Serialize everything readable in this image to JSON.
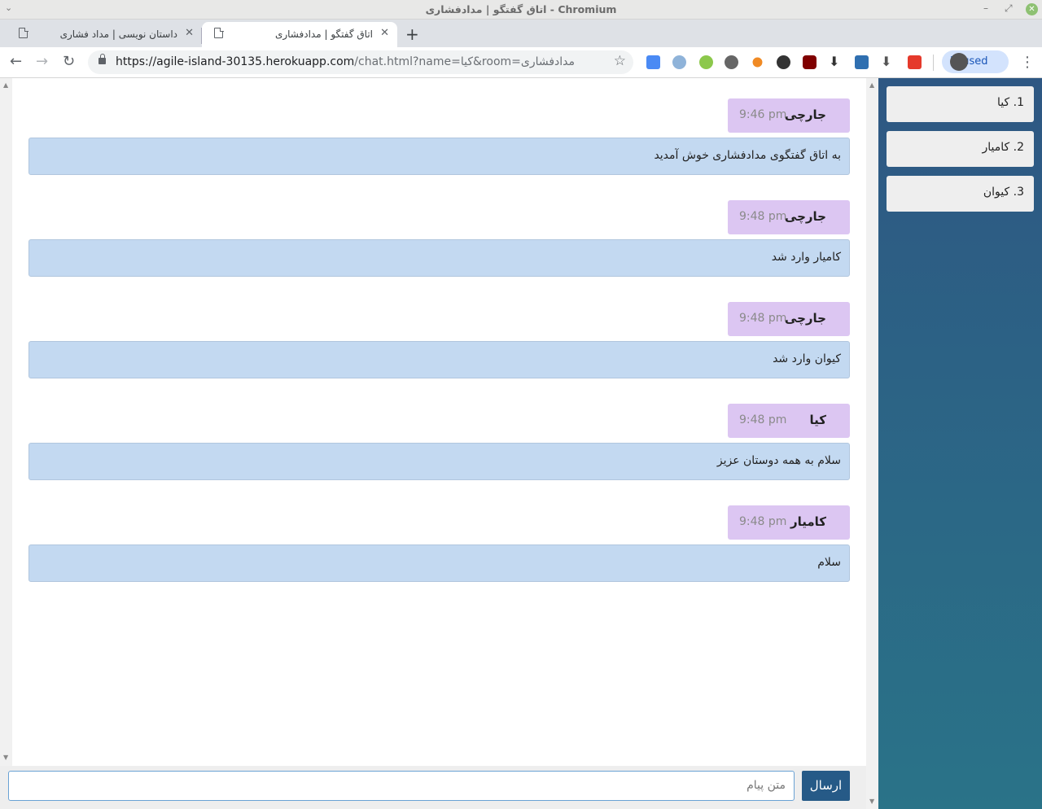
{
  "window": {
    "title": "اتاق گفتگو | مدادفشاری - Chromium"
  },
  "tabs": [
    {
      "title": "داستان نویسی | مداد فشاری",
      "active": false
    },
    {
      "title": "اتاق گفتگو | مدادفشاری",
      "active": true
    }
  ],
  "toolbar": {
    "url_host": "https://agile-island-30135.herokuapp.com",
    "url_path": "/chat.html?name=کیا&room=مدادفشاری",
    "profile_label": "Paused"
  },
  "messages": [
    {
      "sender": "جارچی",
      "time": "9:46 pm",
      "text": "به اتاق گفتگوی مدادفشاری خوش آمدید"
    },
    {
      "sender": "جارچی",
      "time": "9:48 pm",
      "text": "کامیار وارد شد"
    },
    {
      "sender": "جارچی",
      "time": "9:48 pm",
      "text": "کیوان وارد شد"
    },
    {
      "sender": "کیا",
      "time": "9:48 pm",
      "text": "سلام به همه دوستان عزیز"
    },
    {
      "sender": "کامیار",
      "time": "9:48 pm",
      "text": "سلام"
    }
  ],
  "composer": {
    "placeholder": "متن پیام",
    "send_label": "ارسال"
  },
  "users": [
    {
      "label": "1. کیا"
    },
    {
      "label": "2. کامیار"
    },
    {
      "label": "3. کیوان"
    }
  ],
  "colors": {
    "accent": "#265a87",
    "header_bubble": "#dcc6f2",
    "message_bubble": "#c3d9f1",
    "sidebar_top": "#2e5783",
    "sidebar_bottom": "#2a7388"
  }
}
